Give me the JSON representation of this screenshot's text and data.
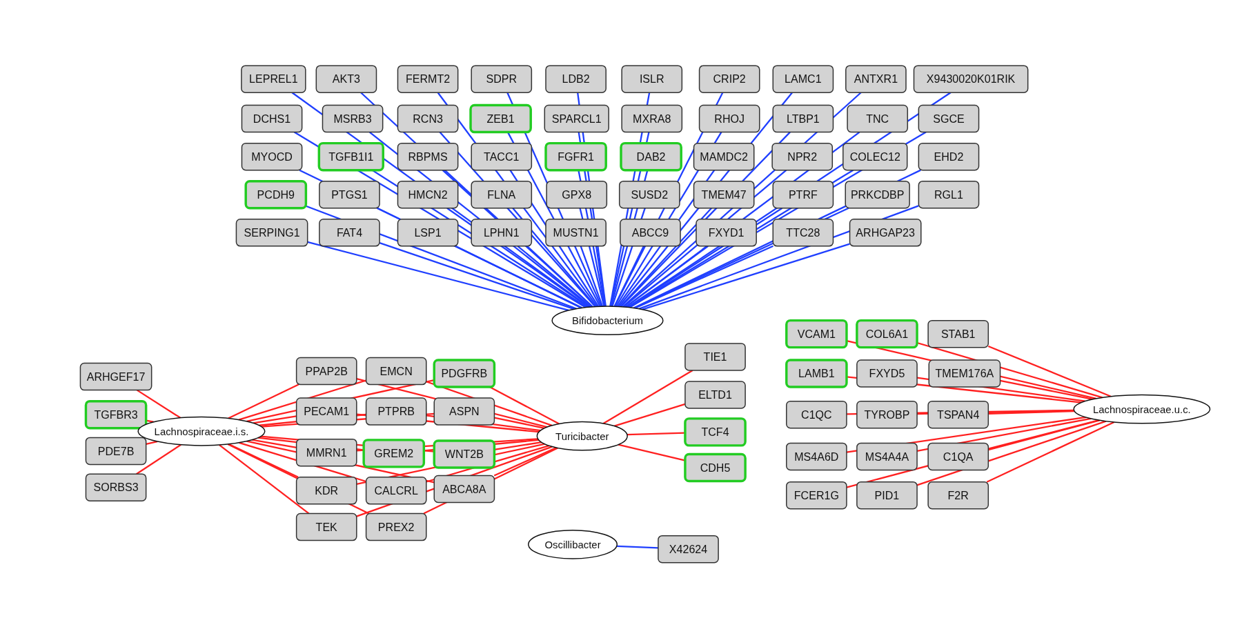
{
  "clusters": [
    {
      "color": "#1f3fff",
      "hubs": [
        {
          "label": "Bifidobacterium"
        }
      ],
      "genes": [
        {
          "label": "LEPREL1",
          "highlighted": false
        },
        {
          "label": "AKT3",
          "highlighted": false
        },
        {
          "label": "FERMT2",
          "highlighted": false
        },
        {
          "label": "SDPR",
          "highlighted": false
        },
        {
          "label": "LDB2",
          "highlighted": false
        },
        {
          "label": "ISLR",
          "highlighted": false
        },
        {
          "label": "CRIP2",
          "highlighted": false
        },
        {
          "label": "LAMC1",
          "highlighted": false
        },
        {
          "label": "ANTXR1",
          "highlighted": false
        },
        {
          "label": "X9430020K01RIK",
          "highlighted": false
        },
        {
          "label": "DCHS1",
          "highlighted": false
        },
        {
          "label": "MSRB3",
          "highlighted": false
        },
        {
          "label": "RCN3",
          "highlighted": false
        },
        {
          "label": "ZEB1",
          "highlighted": true
        },
        {
          "label": "SPARCL1",
          "highlighted": false
        },
        {
          "label": "MXRA8",
          "highlighted": false
        },
        {
          "label": "RHOJ",
          "highlighted": false
        },
        {
          "label": "LTBP1",
          "highlighted": false
        },
        {
          "label": "TNC",
          "highlighted": false
        },
        {
          "label": "SGCE",
          "highlighted": false
        },
        {
          "label": "MYOCD",
          "highlighted": false
        },
        {
          "label": "TGFB1I1",
          "highlighted": true
        },
        {
          "label": "RBPMS",
          "highlighted": false
        },
        {
          "label": "TACC1",
          "highlighted": false
        },
        {
          "label": "FGFR1",
          "highlighted": true
        },
        {
          "label": "DAB2",
          "highlighted": true
        },
        {
          "label": "MAMDC2",
          "highlighted": false
        },
        {
          "label": "NPR2",
          "highlighted": false
        },
        {
          "label": "COLEC12",
          "highlighted": false
        },
        {
          "label": "EHD2",
          "highlighted": false
        },
        {
          "label": "PCDH9",
          "highlighted": true
        },
        {
          "label": "PTGS1",
          "highlighted": false
        },
        {
          "label": "HMCN2",
          "highlighted": false
        },
        {
          "label": "FLNA",
          "highlighted": false
        },
        {
          "label": "GPX8",
          "highlighted": false
        },
        {
          "label": "SUSD2",
          "highlighted": false
        },
        {
          "label": "TMEM47",
          "highlighted": false
        },
        {
          "label": "PTRF",
          "highlighted": false
        },
        {
          "label": "PRKCDBP",
          "highlighted": false
        },
        {
          "label": "RGL1",
          "highlighted": false
        },
        {
          "label": "SERPING1",
          "highlighted": false
        },
        {
          "label": "FAT4",
          "highlighted": false
        },
        {
          "label": "LSP1",
          "highlighted": false
        },
        {
          "label": "LPHN1",
          "highlighted": false
        },
        {
          "label": "MUSTN1",
          "highlighted": false
        },
        {
          "label": "ABCC9",
          "highlighted": false
        },
        {
          "label": "FXYD1",
          "highlighted": false
        },
        {
          "label": "TTC28",
          "highlighted": false
        },
        {
          "label": "ARHGAP23",
          "highlighted": false
        }
      ]
    },
    {
      "color": "#ff2020",
      "hubs": [
        {
          "label": "Lachnospiraceae.i.s."
        },
        {
          "label": "Turicibacter"
        }
      ],
      "genes": [
        {
          "label": "ARHGEF17",
          "highlighted": false,
          "kind": "left"
        },
        {
          "label": "TGFBR3",
          "highlighted": true,
          "kind": "left"
        },
        {
          "label": "PDE7B",
          "highlighted": false,
          "kind": "left"
        },
        {
          "label": "SORBS3",
          "highlighted": false,
          "kind": "left"
        },
        {
          "label": "PPAP2B",
          "highlighted": false,
          "kind": "both"
        },
        {
          "label": "EMCN",
          "highlighted": false,
          "kind": "both"
        },
        {
          "label": "PDGFRB",
          "highlighted": true,
          "kind": "both"
        },
        {
          "label": "PECAM1",
          "highlighted": false,
          "kind": "both"
        },
        {
          "label": "PTPRB",
          "highlighted": false,
          "kind": "both"
        },
        {
          "label": "ASPN",
          "highlighted": false,
          "kind": "both"
        },
        {
          "label": "MMRN1",
          "highlighted": false,
          "kind": "both"
        },
        {
          "label": "GREM2",
          "highlighted": true,
          "kind": "both"
        },
        {
          "label": "WNT2B",
          "highlighted": true,
          "kind": "both"
        },
        {
          "label": "KDR",
          "highlighted": false,
          "kind": "both"
        },
        {
          "label": "CALCRL",
          "highlighted": false,
          "kind": "both"
        },
        {
          "label": "ABCA8A",
          "highlighted": false,
          "kind": "both"
        },
        {
          "label": "TEK",
          "highlighted": false,
          "kind": "both"
        },
        {
          "label": "PREX2",
          "highlighted": false,
          "kind": "both"
        },
        {
          "label": "TIE1",
          "highlighted": false,
          "kind": "right"
        },
        {
          "label": "ELTD1",
          "highlighted": false,
          "kind": "right"
        },
        {
          "label": "TCF4",
          "highlighted": true,
          "kind": "right"
        },
        {
          "label": "CDH5",
          "highlighted": true,
          "kind": "right"
        }
      ]
    },
    {
      "color": "#1f3fff",
      "hubs": [
        {
          "label": "Oscillibacter"
        }
      ],
      "genes": [
        {
          "label": "X42624",
          "highlighted": false
        }
      ]
    },
    {
      "color": "#ff2020",
      "hubs": [
        {
          "label": "Lachnospiraceae.u.c."
        }
      ],
      "genes": [
        {
          "label": "VCAM1",
          "highlighted": true
        },
        {
          "label": "COL6A1",
          "highlighted": true
        },
        {
          "label": "STAB1",
          "highlighted": false
        },
        {
          "label": "LAMB1",
          "highlighted": true
        },
        {
          "label": "FXYD5",
          "highlighted": false
        },
        {
          "label": "TMEM176A",
          "highlighted": false
        },
        {
          "label": "C1QC",
          "highlighted": false
        },
        {
          "label": "TYROBP",
          "highlighted": false
        },
        {
          "label": "TSPAN4",
          "highlighted": false
        },
        {
          "label": "MS4A6D",
          "highlighted": false
        },
        {
          "label": "MS4A4A",
          "highlighted": false
        },
        {
          "label": "C1QA",
          "highlighted": false
        },
        {
          "label": "FCER1G",
          "highlighted": false
        },
        {
          "label": "PID1",
          "highlighted": false
        },
        {
          "label": "F2R",
          "highlighted": false
        }
      ]
    }
  ]
}
